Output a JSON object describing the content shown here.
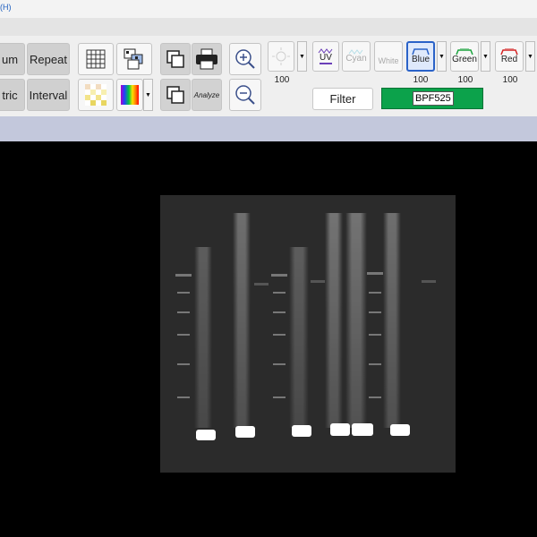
{
  "menu": {
    "tail_text": "(H)"
  },
  "toolbar": {
    "btn_maximum_label": "um",
    "btn_repeat_label": "Repeat",
    "btn_photometric_label": "tric",
    "btn_interval_label": "Interval",
    "analyze_label": "Analyze",
    "filters": {
      "uv": {
        "label": "UV"
      },
      "cyan": {
        "label": "Cyan"
      },
      "white": {
        "label": "White"
      },
      "blue": {
        "label": "Blue",
        "value": "100"
      },
      "green": {
        "label": "Green",
        "value": "100"
      },
      "red": {
        "label": "Red",
        "value": "100"
      },
      "epi_value": "100"
    },
    "filter_button_label": "Filter",
    "filter_value": "BPF525"
  },
  "colors": {
    "toolbar_bg": "#efefef",
    "band_bg": "#c3c8dc",
    "filter_field": "#0ca24b",
    "uv": "#6b3fb8",
    "green": "#1aa33d",
    "red": "#d32222",
    "blue": "#2a62c8"
  },
  "icons": {
    "grid": "grid-icon",
    "layers": "layers-icon",
    "copy": "copy-icon",
    "print": "print-icon",
    "zoom_in": "zoom-in-icon",
    "zoom_out": "zoom-out-icon",
    "checker": "checker-icon",
    "palette": "rainbow-palette-icon",
    "snapshot": "snapshot-icon",
    "epi": "epi-light-icon"
  }
}
